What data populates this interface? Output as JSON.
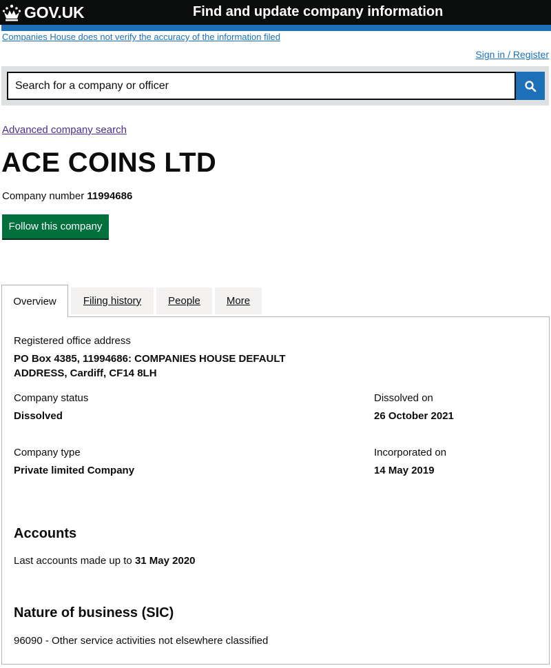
{
  "header": {
    "logo_text": "GOV.UK",
    "service_name": "Find and update company information",
    "colors": {
      "header_bg": "#0b0c0c",
      "accent": "#1d70b8",
      "follow_green": "#00703c"
    }
  },
  "banner": {
    "disclaimer": "Companies House does not verify the accuracy of the information filed",
    "signin": "Sign in / Register"
  },
  "search": {
    "placeholder": "Search for a company or officer",
    "button_icon": "search-icon"
  },
  "advanced_search": "Advanced company search",
  "company": {
    "name": "ACE COINS LTD",
    "number_label": "Company number",
    "number": "11994686",
    "follow_label": "Follow this company"
  },
  "tabs": [
    {
      "label": "Overview",
      "active": true
    },
    {
      "label": "Filing history",
      "active": false
    },
    {
      "label": "People",
      "active": false
    },
    {
      "label": "More",
      "active": false
    }
  ],
  "overview": {
    "office_label": "Registered office address",
    "office_line1": "PO Box 4385, 11994686: COMPANIES HOUSE DEFAULT",
    "office_line2": "ADDRESS, Cardiff, CF14 8LH",
    "status_label": "Company status",
    "status_value": "Dissolved",
    "dissolved_label": "Dissolved on",
    "dissolved_value": "26 October 2021",
    "type_label": "Company type",
    "type_value": "Private limited Company",
    "incorporated_label": "Incorporated on",
    "incorporated_value": "14 May 2019"
  },
  "accounts": {
    "title": "Accounts",
    "text": "Last accounts made up to",
    "date": "31 May 2020"
  },
  "sic": {
    "title": "Nature of business (SIC)",
    "item": "96090 - Other service activities not elsewhere classified"
  }
}
